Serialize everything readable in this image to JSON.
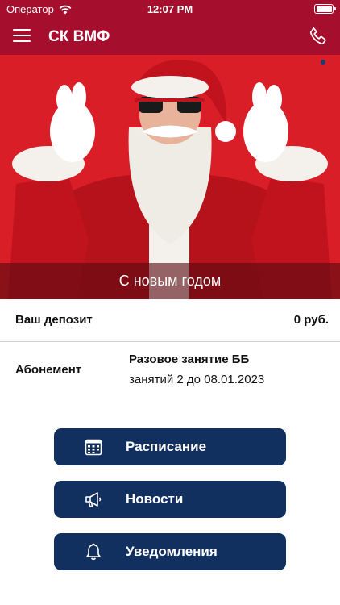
{
  "status_bar": {
    "carrier": "Оператор",
    "time": "12:07 PM"
  },
  "nav": {
    "title": "СК ВМФ",
    "menu_icon": "hamburger-menu-icon",
    "phone_icon": "phone-icon"
  },
  "banner": {
    "caption": "С новым годом",
    "image": "santa-claus-in-sunglasses-photo"
  },
  "deposit": {
    "label": "Ваш депозит",
    "value": "0 руб."
  },
  "subscription": {
    "label": "Абонемент",
    "title": "Разовое занятие ББ",
    "detail": "занятий 2 до 08.01.2023"
  },
  "actions": [
    {
      "label": "Расписание",
      "icon": "calendar-icon"
    },
    {
      "label": "Новости",
      "icon": "megaphone-icon"
    },
    {
      "label": "Уведомления",
      "icon": "bell-icon"
    }
  ],
  "colors": {
    "header": "#a50e2d",
    "button": "#12305f",
    "banner_bg": "#d91e27"
  }
}
